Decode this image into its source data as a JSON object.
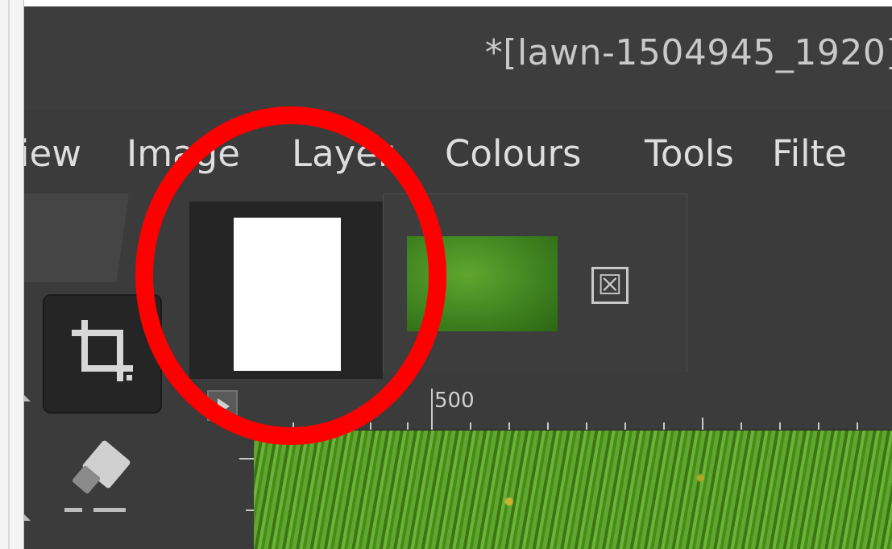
{
  "window": {
    "title": "*[lawn-1504945_1920]"
  },
  "menubar": {
    "items": [
      "iew",
      "Image",
      "Layer",
      "Colours",
      "Tools",
      "Filte"
    ]
  },
  "toolbox": {
    "tools": [
      {
        "icon": "crop-icon",
        "active": true
      },
      {
        "icon": "eraser-icon",
        "active": false
      }
    ]
  },
  "image_tabs": [
    {
      "thumbnail": "white-blank-image",
      "active": true
    },
    {
      "thumbnail": "lawn-grass-image",
      "active": false,
      "close_icon": "close-icon",
      "close_glyph": "☒"
    }
  ],
  "ruler": {
    "label": "500"
  },
  "annotation": {
    "shape": "circle",
    "color": "#ff0000",
    "highlights": "active-image-tab"
  },
  "colors": {
    "ui_background": "#3b3b3b",
    "active_tab": "#252525",
    "text": "#dedede"
  }
}
